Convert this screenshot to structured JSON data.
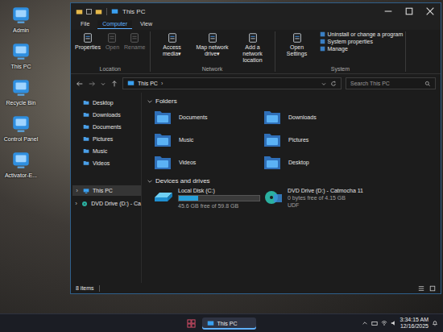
{
  "desktop": {
    "icons": [
      {
        "label": "Admin"
      },
      {
        "label": "This PC"
      },
      {
        "label": "Recycle Bin"
      },
      {
        "label": "Control Panel"
      },
      {
        "label": "Activator-E..."
      }
    ]
  },
  "window": {
    "title": "This PC"
  },
  "ribbon": {
    "tabs": [
      {
        "label": "File",
        "selected": false
      },
      {
        "label": "Computer",
        "selected": true
      },
      {
        "label": "View",
        "selected": false
      }
    ],
    "groups": [
      {
        "label": "Location",
        "buttons": [
          {
            "label": "Properties",
            "disabled": false
          },
          {
            "label": "Open",
            "disabled": true
          },
          {
            "label": "Rename",
            "disabled": true
          }
        ],
        "links": []
      },
      {
        "label": "Network",
        "buttons": [
          {
            "label": "Access media",
            "arrow": "▾",
            "disabled": false
          },
          {
            "label": "Map network drive",
            "arrow": "▾",
            "disabled": false
          },
          {
            "label": "Add a network location",
            "disabled": false
          }
        ],
        "links": []
      },
      {
        "label": "System",
        "buttons": [
          {
            "label": "Open Settings",
            "disabled": false
          }
        ],
        "links": [
          "Uninstall or change a program",
          "System properties",
          "Manage"
        ]
      }
    ]
  },
  "address": {
    "path": "This PC",
    "separator": "›"
  },
  "search": {
    "placeholder": "Search This PC"
  },
  "sidebar": {
    "pinned": [
      {
        "label": "Desktop",
        "selected": false
      },
      {
        "label": "Downloads",
        "selected": false
      },
      {
        "label": "Documents",
        "selected": false
      },
      {
        "label": "Pictures",
        "selected": false
      },
      {
        "label": "Music",
        "selected": false
      },
      {
        "label": "Videos",
        "selected": false
      }
    ],
    "tree": [
      {
        "label": "This PC",
        "chevron": "›",
        "kind": "pc",
        "selected": true,
        "expanded": false
      },
      {
        "label": "DVD Drive (D:) - Ca",
        "chevron": "›",
        "kind": "dvd",
        "selected": false,
        "expanded": false
      }
    ]
  },
  "folders": {
    "header": "Folders",
    "expanded": true,
    "items": [
      {
        "label": "Documents"
      },
      {
        "label": "Downloads"
      },
      {
        "label": "Music"
      },
      {
        "label": "Pictures"
      },
      {
        "label": "Videos"
      },
      {
        "label": "Desktop"
      }
    ]
  },
  "drives": {
    "header": "Devices and drives",
    "expanded": true,
    "items": [
      {
        "name": "Local Disk (C:)",
        "kind": "disk",
        "level": 0.24,
        "free": "45.6 GB free of 59.8 GB"
      },
      {
        "name": "DVD Drive (D:) - Catmocha 11",
        "kind": "dvd",
        "free": "0 bytes free of 4.15 GB",
        "filesystem": "UDF"
      }
    ]
  },
  "status_bar": {
    "count": "8 items"
  },
  "taskbar": {
    "apps": [
      {
        "label": "This PC",
        "selected": true
      }
    ],
    "clock": {
      "time": "3:34:15 AM",
      "date": "12/16/2025"
    }
  }
}
